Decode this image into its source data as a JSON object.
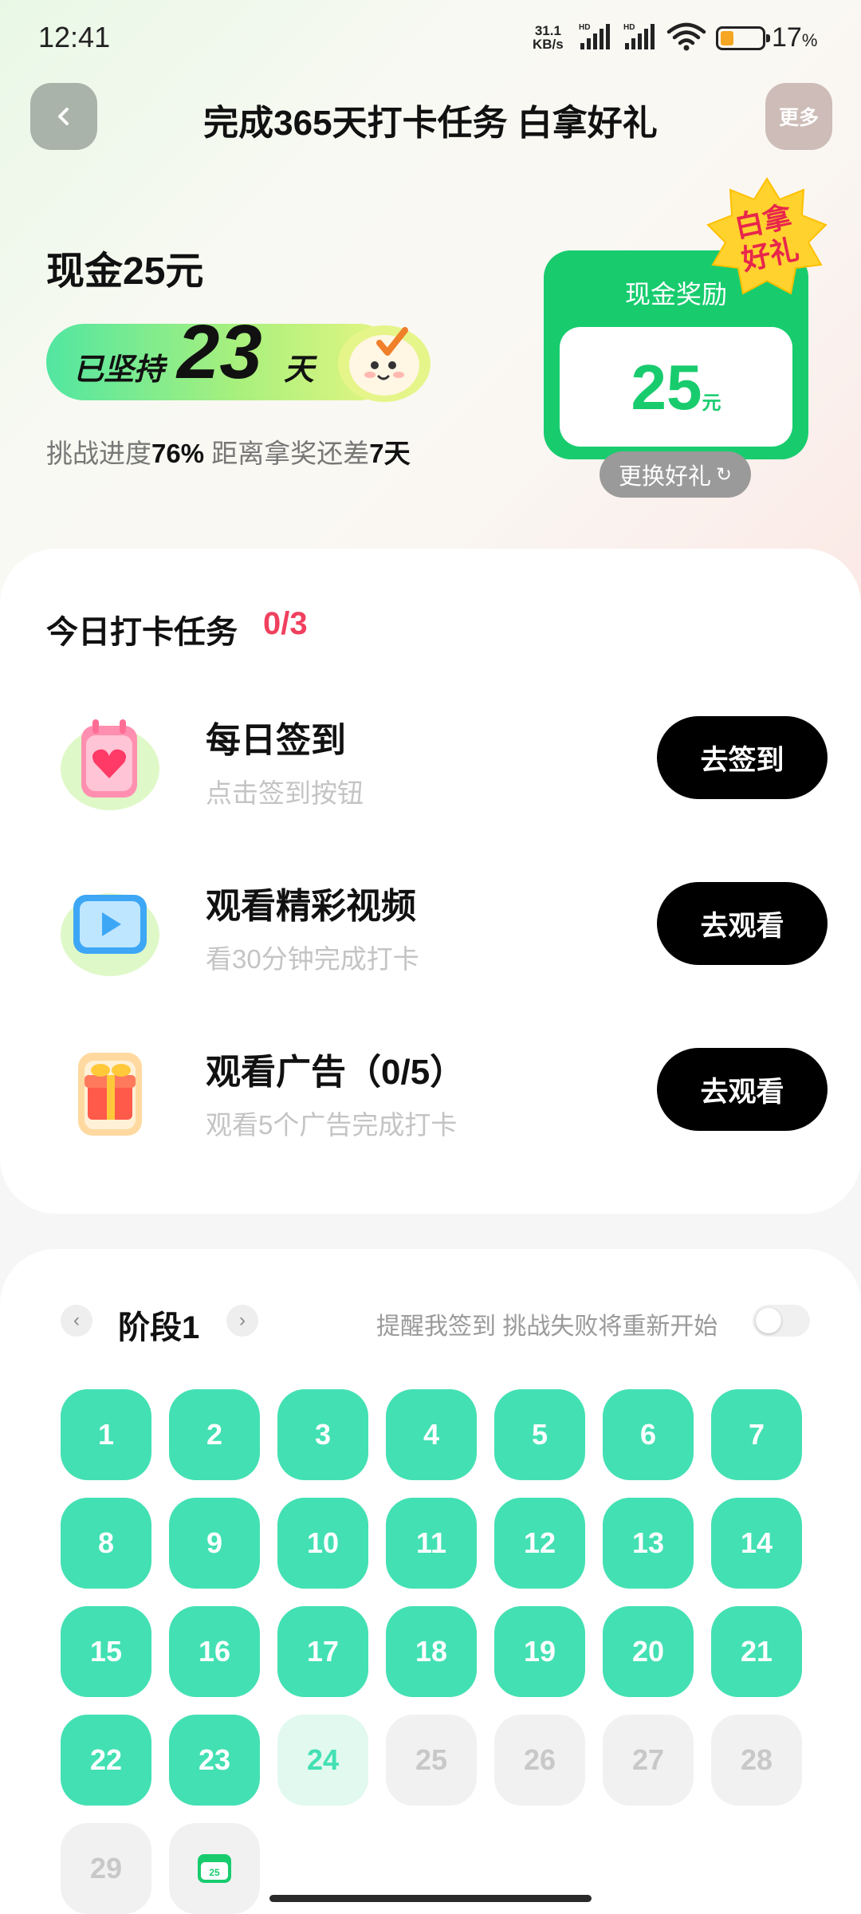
{
  "status_bar": {
    "time": "12:41",
    "net_speed_top": "31.1",
    "net_speed_bottom": "KB/s",
    "sim1": "HD",
    "sim2": "HD",
    "battery_level": 0.17,
    "battery_percent": "17",
    "battery_unit": "%"
  },
  "header": {
    "title": "完成365天打卡任务 白拿好礼",
    "more_label": "更多"
  },
  "hero": {
    "cash_title": "现金25元",
    "streak_prefix": "已坚持",
    "streak_days": "23",
    "streak_unit": "天",
    "progress_pre": "挑战进度",
    "progress_value": "76%",
    "progress_mid": " 距离拿奖还差",
    "remaining": "7天",
    "reward_label": "现金奖励",
    "reward_amount": "25",
    "reward_unit": "元",
    "badge_line1": "白拿",
    "badge_line2": "好礼",
    "change_gift_label": "更换好礼",
    "refresh_glyph": "↻"
  },
  "tasks": {
    "title": "今日打卡任务",
    "count": "0/3",
    "items": [
      {
        "name": "每日签到",
        "desc": "点击签到按钮",
        "button": "去签到",
        "icon": "calendar-heart-icon"
      },
      {
        "name": "观看精彩视频",
        "desc": "看30分钟完成打卡",
        "button": "去观看",
        "icon": "video-play-icon"
      },
      {
        "name": "观看广告（0/5）",
        "desc": "观看5个广告完成打卡",
        "button": "去观看",
        "icon": "gift-box-icon"
      }
    ]
  },
  "calendar": {
    "stage_label": "阶段1",
    "prev_glyph": "‹",
    "next_glyph": "›",
    "remind_label": "提醒我签到 挑战失败将重新开始",
    "remind_enabled": false,
    "days": [
      "1",
      "2",
      "3",
      "4",
      "5",
      "6",
      "7",
      "8",
      "9",
      "10",
      "11",
      "12",
      "13",
      "14",
      "15",
      "16",
      "17",
      "18",
      "19",
      "20",
      "21",
      "22",
      "23",
      "24",
      "25",
      "26",
      "27",
      "28",
      "29"
    ],
    "completed_days": 23,
    "current_day": 24,
    "gift_mini_amount": "25"
  },
  "colors": {
    "accent_green": "#43e0b3",
    "reward_green": "#18cc6e",
    "count_red": "#f0405e",
    "button_black": "#000000"
  }
}
